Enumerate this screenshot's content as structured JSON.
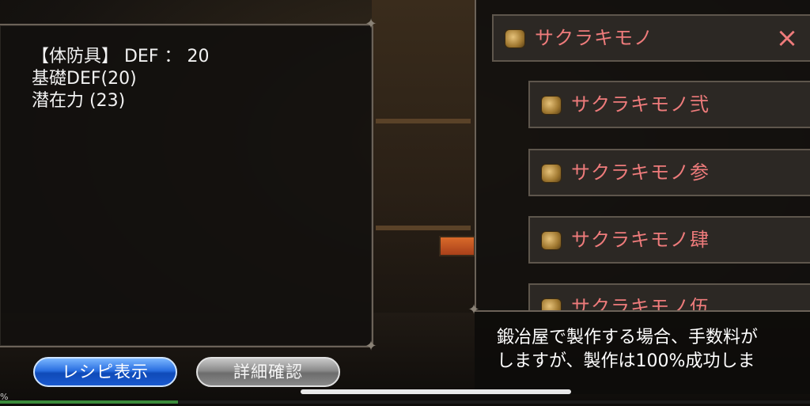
{
  "stats": {
    "line1": "【体防具】 DEF ： 20",
    "line2": "基礎DEF(20)",
    "line3": "潜在力 (23)"
  },
  "header_item": {
    "label": "サクラキモノ",
    "close_icon": "×"
  },
  "items": [
    {
      "label": "サクラキモノ弐"
    },
    {
      "label": "サクラキモノ参"
    },
    {
      "label": "サクラキモノ肆"
    },
    {
      "label": "サクラキモノ伍"
    }
  ],
  "message": {
    "line1": "鍛冶屋で製作する場合、手数料が",
    "line2": "しますが、製作は100%成功しま"
  },
  "buttons": {
    "recipe": "レシピ表示",
    "detail": "詳細確認"
  },
  "progress": {
    "label": "%",
    "value": 0.22
  },
  "colors": {
    "item_text": "#ee7b7b",
    "recipe_button": "#1a5ad0",
    "detail_button": "#8a8a8a"
  },
  "icons": {
    "item": "kimono-item-icon",
    "close": "close-icon",
    "ornament": "corner-ornament-icon"
  }
}
